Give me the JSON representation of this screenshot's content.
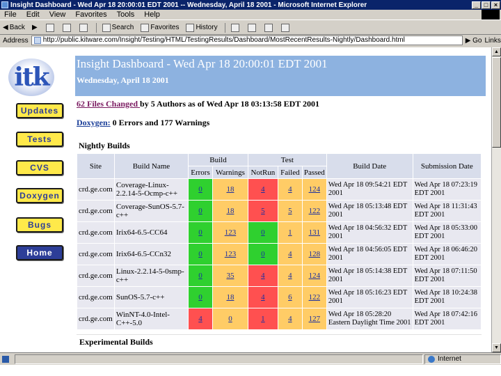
{
  "window": {
    "title": "Insight Dashboard - Wed Apr 18 20:00:01 EDT 2001 -- Wednesday, April 18 2001 - Microsoft Internet Explorer"
  },
  "menu": [
    "File",
    "Edit",
    "View",
    "Favorites",
    "Tools",
    "Help"
  ],
  "toolbar": {
    "back": "Back",
    "search": "Search",
    "favorites": "Favorites",
    "history": "History"
  },
  "address": {
    "label": "Address",
    "url": "http://public.kitware.com/Insight/Testing/HTML/TestingResults/Dashboard/MostRecentResults-Nightly/Dashboard.html",
    "go": "Go",
    "links": "Links"
  },
  "nav": {
    "logo": "itk",
    "buttons": [
      "Updates",
      "Tests",
      "CVS",
      "Doxygen",
      "Bugs",
      "Home"
    ]
  },
  "banner": {
    "title": "Insight Dashboard - Wed Apr 18 20:00:01 EDT 2001",
    "subtitle": "Wednesday, April 18 2001"
  },
  "changes": {
    "link": "62 Files Changed ",
    "text": "by 5 Authors as of Wed Apr 18 03:13:58 EDT 2001"
  },
  "doxygen": {
    "link": "Doxygen:",
    "text": " 0 Errors and 177 Warnings"
  },
  "nightly": {
    "caption": "Nightly Builds",
    "headers": {
      "site": "Site",
      "build_name": "Build Name",
      "build": "Build",
      "test": "Test",
      "build_date": "Build Date",
      "submission_date": "Submission Date",
      "errors": "Errors",
      "warnings": "Warnings",
      "notrun": "NotRun",
      "failed": "Failed",
      "passed": "Passed"
    },
    "rows": [
      {
        "site": "crd.ge.com",
        "name": "Coverage-Linux-2.2.14-5-Ocmp-c++",
        "errors": "0",
        "warnings": "18",
        "notrun": "4",
        "failed": "4",
        "passed": "124",
        "build_date": "Wed Apr 18 09:54:21 EDT 2001",
        "sub_date": "Wed Apr 18 07:23:19 EDT 2001"
      },
      {
        "site": "crd.ge.com",
        "name": "Coverage-SunOS-5.7-c++",
        "errors": "0",
        "warnings": "18",
        "notrun": "5",
        "failed": "5",
        "passed": "122",
        "build_date": "Wed Apr 18 05:13:48 EDT 2001",
        "sub_date": "Wed Apr 18 11:31:43 EDT 2001"
      },
      {
        "site": "crd.ge.com",
        "name": "Irix64-6.5-CC64",
        "errors": "0",
        "warnings": "123",
        "notrun": "0",
        "failed": "1",
        "passed": "131",
        "build_date": "Wed Apr 18 04:56:32 EDT 2001",
        "sub_date": "Wed Apr 18 05:33:00 EDT 2001"
      },
      {
        "site": "crd.ge.com",
        "name": "Irix64-6.5-CCn32",
        "errors": "0",
        "warnings": "123",
        "notrun": "0",
        "failed": "4",
        "passed": "128",
        "build_date": "Wed Apr 18 04:56:05 EDT 2001",
        "sub_date": "Wed Apr 18 06:46:20 EDT 2001"
      },
      {
        "site": "crd.ge.com",
        "name": "Linux-2.2.14-5-0smp-c++",
        "errors": "0",
        "warnings": "35",
        "notrun": "4",
        "failed": "4",
        "passed": "124",
        "build_date": "Wed Apr 18 05:14:38 EDT 2001",
        "sub_date": "Wed Apr 18 07:11:50 EDT 2001"
      },
      {
        "site": "crd.ge.com",
        "name": "SunOS-5.7-c++",
        "errors": "0",
        "warnings": "18",
        "notrun": "4",
        "failed": "6",
        "passed": "122",
        "build_date": "Wed Apr 18 05:16:23 EDT 2001",
        "sub_date": "Wed Apr 18 10:24:38 EDT 2001"
      },
      {
        "site": "crd.ge.com",
        "name": "WinNT-4.0-Intel-C++-5.0",
        "errors": "4",
        "warnings": "0",
        "notrun": "1",
        "failed": "4",
        "passed": "127",
        "build_date": "Wed Apr 18 05:28:20 Eastern Daylight Time 2001",
        "sub_date": "Wed Apr 18 07:42:16 EDT 2001"
      }
    ]
  },
  "experimental": {
    "caption": "Experimental Builds"
  },
  "status": {
    "zone": "Internet"
  }
}
